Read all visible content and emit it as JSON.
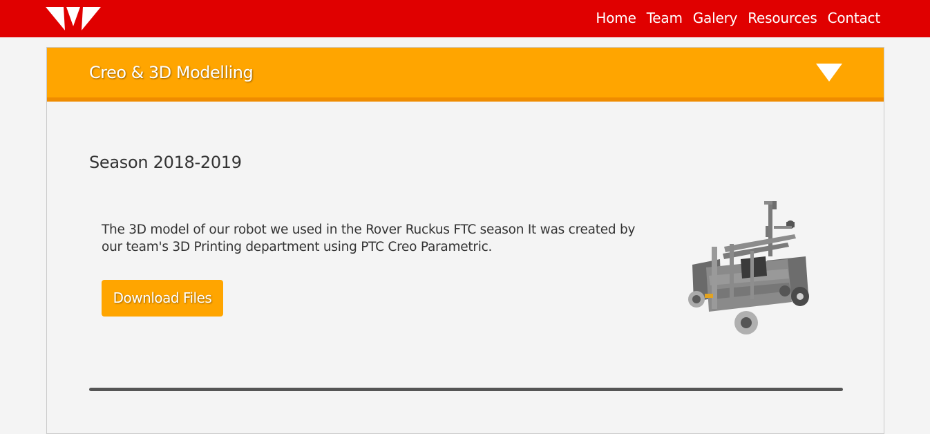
{
  "header": {
    "logo_icon": "team-logo-chevron",
    "nav": [
      "Home",
      "Team",
      "Galery",
      "Resources",
      "Contact"
    ],
    "colors": {
      "bar": "#e00000",
      "text": "#ffffff"
    }
  },
  "panel": {
    "title": "Creo & 3D Modelling",
    "toggle_icon": "triangle-down-icon",
    "accent_color": "#ffa500"
  },
  "content": {
    "season": "Season 2018-2019",
    "description": "The 3D model of our robot we used in the Rover Ruckus FTC season It was created by our team's 3D Printing department using PTC Creo Parametric.",
    "download_label": "Download Files",
    "image_icon": "robot-3d-model-image"
  }
}
